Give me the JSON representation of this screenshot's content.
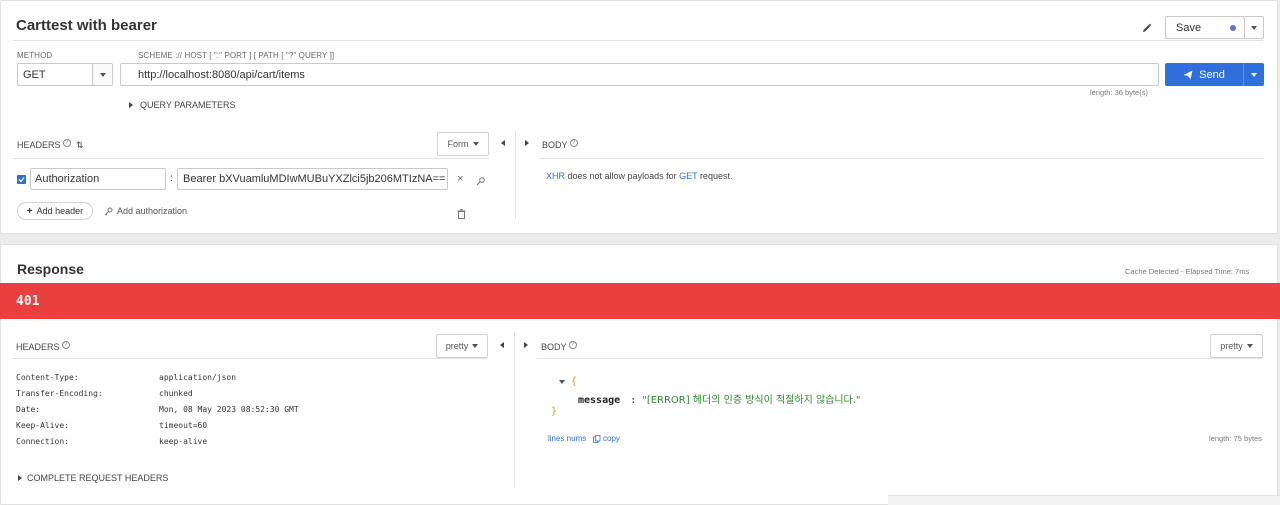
{
  "request": {
    "title": "Carttest with bearer",
    "save_label": "Save",
    "method_label": "METHOD",
    "method_value": "GET",
    "url_hint": "SCHEME :// HOST [ \":\" PORT ] [ PATH [ \"?\" QUERY ]]",
    "url_value": "http://localhost:8080/api/cart/items",
    "send_label": "Send",
    "length_text": "length: 36 byte(s)",
    "query_params_label": "QUERY PARAMETERS",
    "headers_label": "HEADERS",
    "headers_mode": "Form",
    "body_label": "BODY",
    "header_row": {
      "name": "Authorization",
      "separator": ":",
      "value": "Bearer bXVuamluMDIwMUBuYXZlci5jb206MTIzNA=="
    },
    "add_header_label": "Add header",
    "add_authorization_label": "Add authorization",
    "body_notice": {
      "xhr": "XHR",
      "middle": " does not allow payloads for ",
      "get": "GET",
      "end": " request."
    }
  },
  "response": {
    "title": "Response",
    "cache_text": "Cache Detected - Elapsed Time: 7ms",
    "status_code": "401",
    "headers_label": "HEADERS",
    "headers_mode": "pretty",
    "body_label": "BODY",
    "body_mode": "pretty",
    "headers": [
      {
        "name": "Content-Type:",
        "value": "application/json"
      },
      {
        "name": "Transfer-Encoding:",
        "value": "chunked"
      },
      {
        "name": "Date:",
        "value": "Mon, 08 May 2023 08:52:30 GMT"
      },
      {
        "name": "Keep-Alive:",
        "value": "timeout=60"
      },
      {
        "name": "Connection:",
        "value": "keep-alive"
      }
    ],
    "complete_headers_label": "COMPLETE REQUEST HEADERS",
    "json": {
      "open_brace": "{",
      "key": "message",
      "colon": ":",
      "value": "\"[ERROR] 헤더의 인증 방식이 적절하지 않습니다.\"",
      "close_brace": "}"
    },
    "lines_nums_label": "lines nums",
    "copy_label": "copy",
    "body_length": "length: 75 bytes"
  },
  "colors": {
    "accent": "#2f6fdc",
    "error": "#ea3f3f",
    "save_dot": "#5a6ee0"
  },
  "icons": [
    "pencil-icon",
    "chevron-down-icon",
    "paper-plane-icon",
    "help-icon",
    "sort-icon",
    "close-icon",
    "magic-wand-icon",
    "plus-icon",
    "key-icon",
    "trash-icon",
    "copy-icon",
    "triangle-right-icon",
    "triangle-left-icon"
  ]
}
